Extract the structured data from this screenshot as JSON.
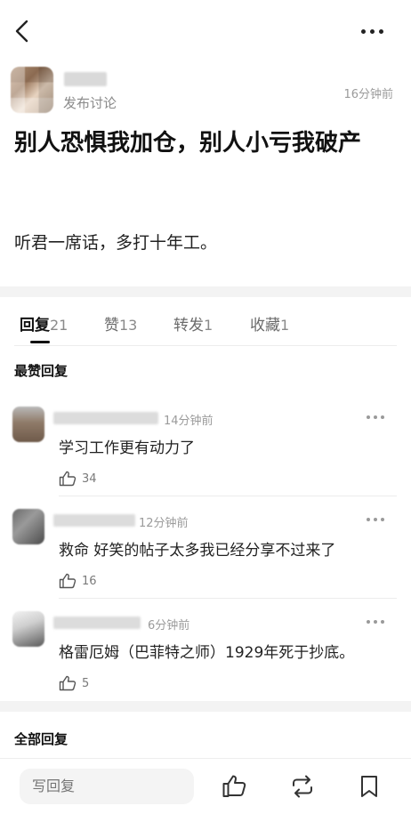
{
  "post": {
    "type_label": "发布讨论",
    "time": "16分钟前",
    "title": "别人恐惧我加仓，别人小亏我破产",
    "body": "听君一席话，多打十年工。"
  },
  "tabs": [
    {
      "label": "回复",
      "count": "21"
    },
    {
      "label": "赞",
      "count": "13"
    },
    {
      "label": "转发",
      "count": "1"
    },
    {
      "label": "收藏",
      "count": "1"
    }
  ],
  "sections": {
    "top": "最赞回复",
    "all": "全部回复"
  },
  "comments": [
    {
      "time": "14分钟前",
      "text": "学习工作更有动力了",
      "likes": "34"
    },
    {
      "time": "12分钟前",
      "text": "救命 好笑的帖子太多我已经分享不过来了",
      "likes": "16"
    },
    {
      "time": "6分钟前",
      "text": "格雷厄姆（巴菲特之师）1929年死于抄底。",
      "likes": "5"
    }
  ],
  "bottom": {
    "reply_placeholder": "写回复"
  },
  "icons": {
    "back": "chevron-left-icon",
    "more": "more-dots-icon",
    "like": "thumbs-up-icon",
    "repost": "repost-icon",
    "bookmark": "bookmark-icon"
  }
}
